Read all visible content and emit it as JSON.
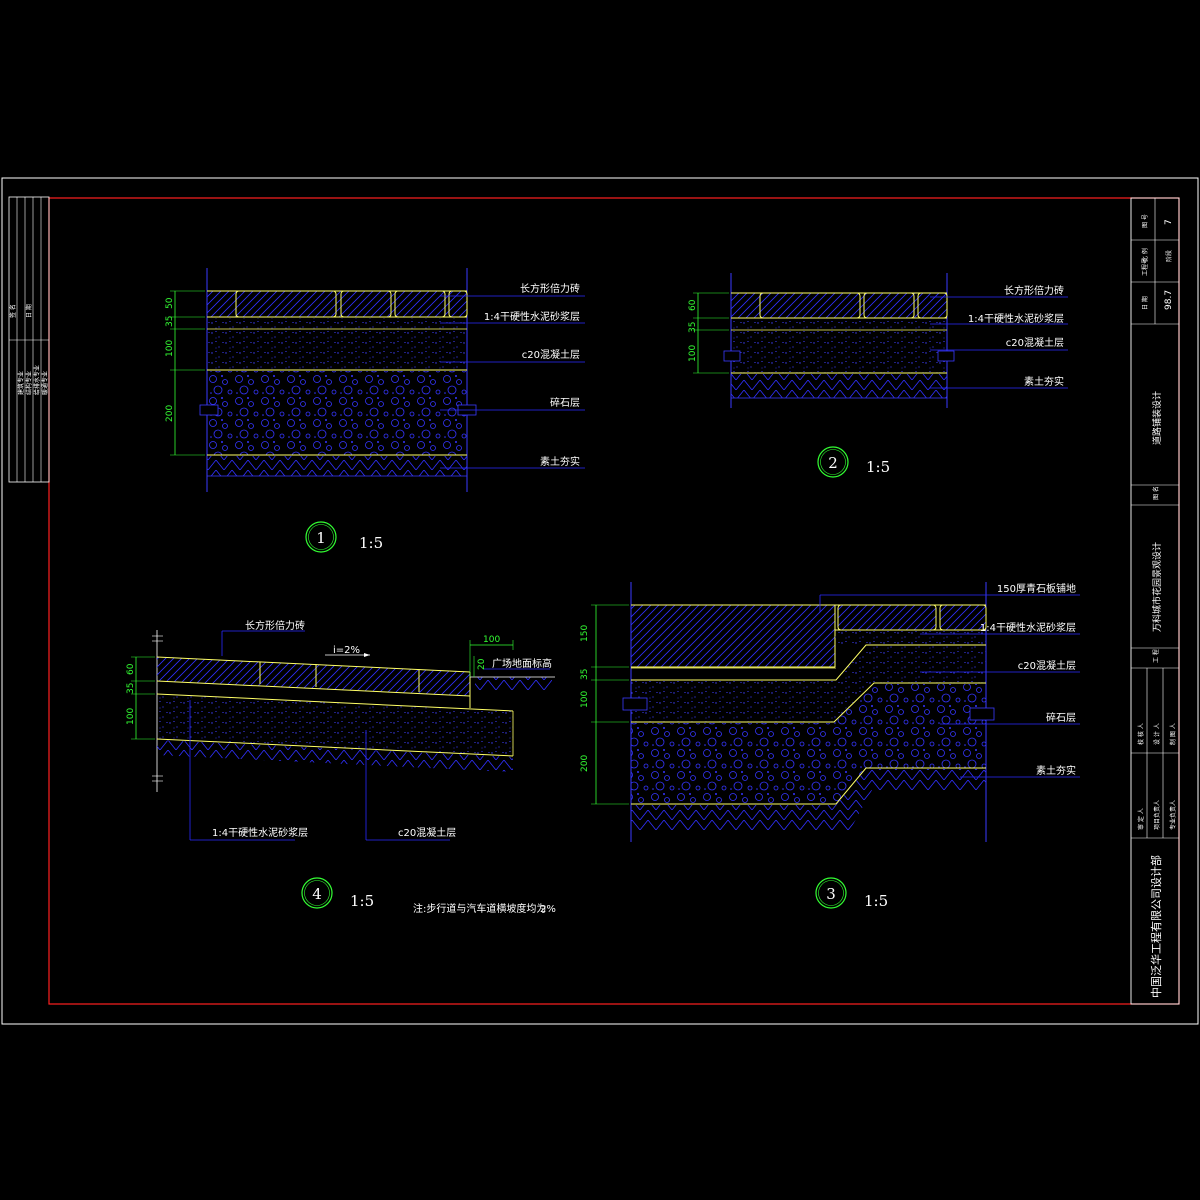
{
  "details": {
    "d1": {
      "labels": [
        "长方形倍力砖",
        "1:4干硬性水泥砂浆层",
        "c20混凝土层",
        "碎石层",
        "素土夯实"
      ],
      "dims": [
        "50",
        "35",
        "100",
        "200"
      ],
      "number": "1",
      "scale": "1:5"
    },
    "d2": {
      "labels": [
        "长方形倍力砖",
        "1:4干硬性水泥砂浆层",
        "c20混凝土层",
        "素土夯实"
      ],
      "dims": [
        "60",
        "35",
        "100"
      ],
      "number": "2",
      "scale": "1:5"
    },
    "d3": {
      "labels": [
        "150厚青石板铺地",
        "1:4干硬性水泥砂浆层",
        "c20混凝土层",
        "碎石层",
        "素土夯实"
      ],
      "dims": [
        "150",
        "35",
        "100",
        "200"
      ],
      "number": "3",
      "scale": "1:5"
    },
    "d4": {
      "top_label": "长方形倍力砖",
      "slope_label": "i=2%",
      "plaza_label": "广场地面标高",
      "dim_100": "100",
      "dim_20": "20",
      "dims": [
        "60",
        "35",
        "100"
      ],
      "bottom_labels": [
        "1:4干硬性水泥砂浆层",
        "c20混凝土层"
      ],
      "number": "4",
      "scale": "1:5"
    }
  },
  "note": "注:步行道与汽车道横坡度均为",
  "note_value": "2%",
  "title_block": {
    "company": "中国泛华工程有限公司设计部",
    "project": "万科城市花园景观设计",
    "drawing_title": "道路铺装设计",
    "project_label": "工 程",
    "drawing_label": "图 名",
    "project_no_label": "工程号",
    "project_no": "98.7",
    "date_label": "日 期",
    "sheet_label": "图 号",
    "sheet_no": "7",
    "scale_label": "比 例",
    "stage_label": "阶段",
    "roles": [
      "审 定 人",
      "项目负责人",
      "专业负责人",
      "校 核 人",
      "设 计 人",
      "制 图 人"
    ],
    "left_strip": [
      "签 名",
      "日 期",
      "建筑专业",
      "结构专业",
      "给排水专业",
      "暖通专业",
      "电气专业"
    ]
  },
  "colors": {
    "frame": "#ffffff",
    "border": "#ff2020",
    "layer_line": "#ffff66",
    "hatch": "#3a3aff",
    "leader": "#2a2aff",
    "dim": "#33ff33"
  }
}
